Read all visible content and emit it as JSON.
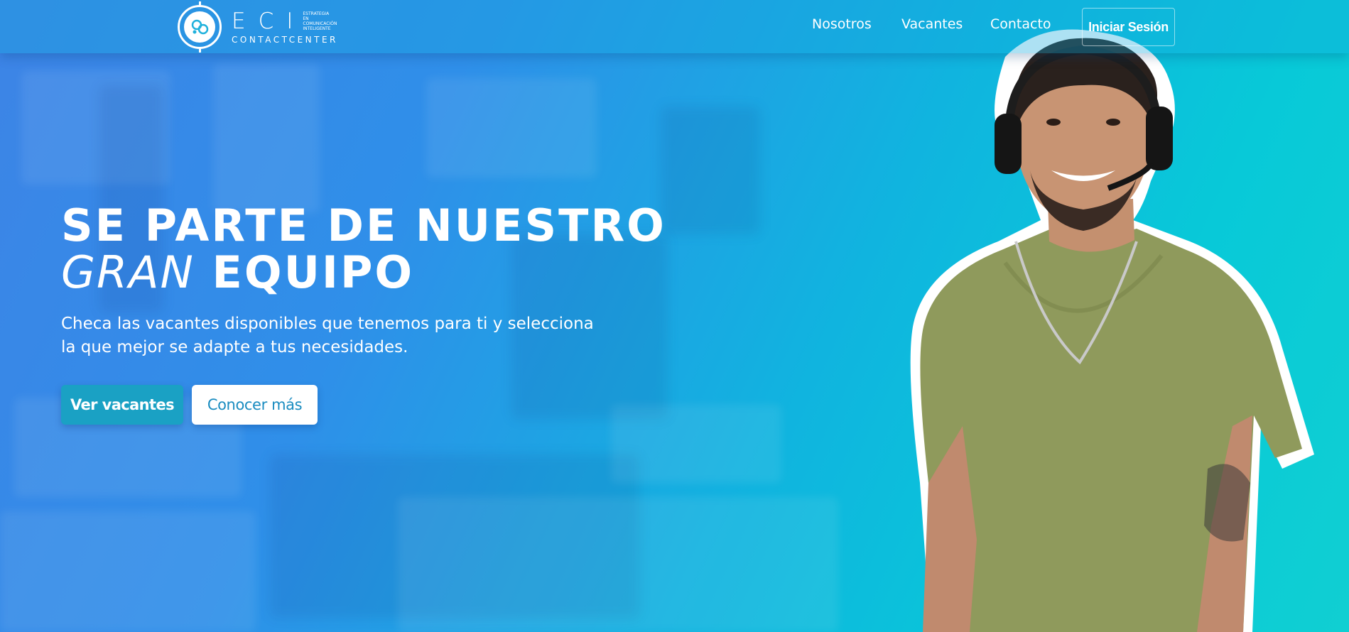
{
  "brand": {
    "logo_main": "ECI",
    "logo_tagline": "ESTRATEGIA EN COMUNICACIÓN INTELIGENTE",
    "logo_sub": "CONTACTCENTER"
  },
  "nav": {
    "items": [
      {
        "label": "Nosotros"
      },
      {
        "label": "Vacantes"
      },
      {
        "label": "Contacto"
      }
    ],
    "login_label": "Iniciar Sesión"
  },
  "hero": {
    "title_line1": "SE PARTE DE NUESTRO",
    "title_italic": "GRAN",
    "title_line2_rest": "EQUIPO",
    "subtitle": "Checa las vacantes disponibles que tenemos para ti y selecciona la que mejor se adapte a tus necesidades.",
    "primary_cta": "Ver vacantes",
    "secondary_cta": "Conocer más"
  },
  "colors": {
    "primary_button": "#1aa1c4",
    "secondary_button_text": "#1a8cc0",
    "gradient_start": "#3d84e6",
    "gradient_end": "#10cfd2",
    "shirt": "#8f9a5c"
  },
  "images": {
    "hero_person": "smiling agent wearing headset and olive t-shirt"
  }
}
